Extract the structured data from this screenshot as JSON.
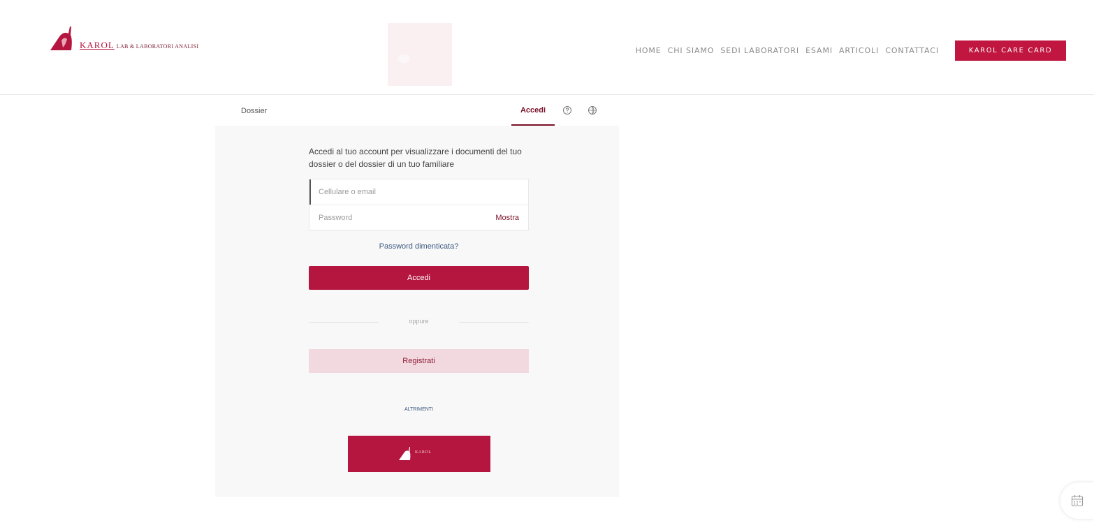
{
  "header": {
    "logo": {
      "brand": "KAROL",
      "subtitle": "LAB & LABORATORI ANALISI"
    },
    "nav": [
      {
        "label": "HOME"
      },
      {
        "label": "CHI SIAMO"
      },
      {
        "label": "SEDI LABORATORI"
      },
      {
        "label": "ESAMI"
      },
      {
        "label": "ARTICOLI"
      },
      {
        "label": "CONTATTACI"
      }
    ],
    "care_button": "KAROL CARE CARD"
  },
  "subbar": {
    "dossier_label": "Dossier",
    "active_tab": "Accedi",
    "icons": [
      "help-icon",
      "language-icon"
    ]
  },
  "login": {
    "intro": "Accedi al tuo account per visualizzare i documenti del tuo dossier o del dossier di un tuo familiare",
    "username_placeholder": "Cellulare o email",
    "password_placeholder": "Password",
    "show_label": "Mostra",
    "forgot_label": "Password dimenticata?",
    "submit_label": "Accedi",
    "divider_label": "oppure",
    "register_label": "Registrati",
    "small_link": "ALTRIMENTI"
  },
  "colors": {
    "brand": "#b5163f",
    "brand_dark": "#7a1028",
    "brand_light": "#f2d9df"
  }
}
